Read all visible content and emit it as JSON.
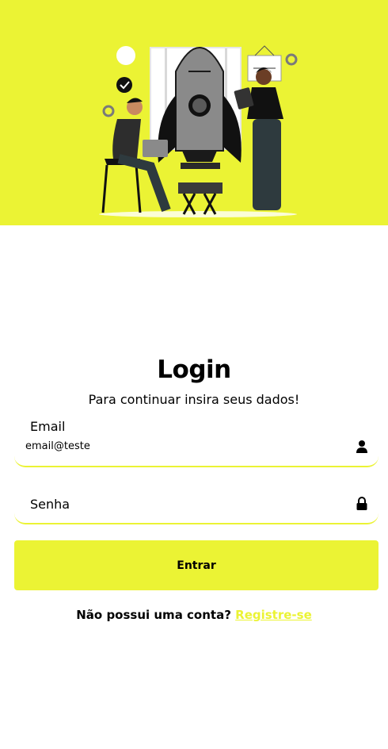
{
  "hero": {
    "illustration": "rocket-team-illustration",
    "background": "#ebf334"
  },
  "login": {
    "title": "Login",
    "subtitle": "Para continuar insira seus dados!",
    "email": {
      "label": "Email",
      "value": "email@teste",
      "icon": "user-icon"
    },
    "password": {
      "label": "Senha",
      "value": "",
      "icon": "lock-icon"
    },
    "submit_label": "Entrar",
    "register_prompt": "Não possui uma conta?",
    "register_link": "Registre-se"
  },
  "colors": {
    "accent": "#ebf334",
    "text": "#000000",
    "background": "#ffffff"
  }
}
